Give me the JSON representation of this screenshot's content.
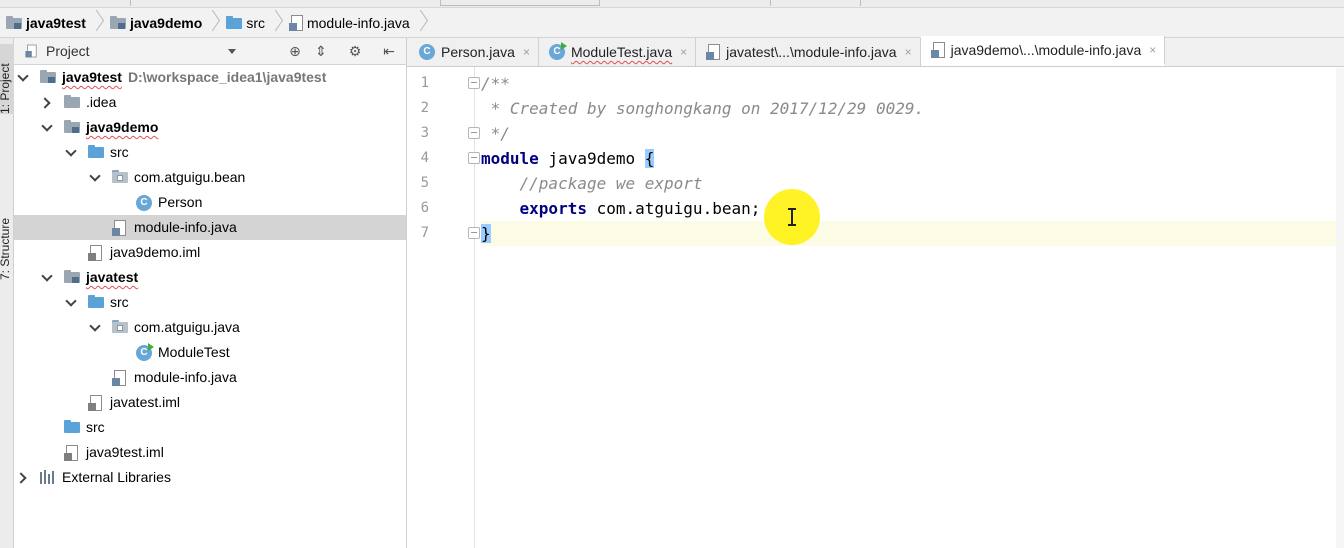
{
  "breadcrumbs": [
    {
      "label": "java9test",
      "icon": "module-folder-icon",
      "bold": true
    },
    {
      "label": "java9demo",
      "icon": "module-folder-icon",
      "bold": true
    },
    {
      "label": "src",
      "icon": "source-folder-icon",
      "bold": false
    },
    {
      "label": "module-info.java",
      "icon": "java-file-icon",
      "bold": false
    }
  ],
  "side_tabs": {
    "project": "1: Project",
    "structure": "7: Structure"
  },
  "project_panel": {
    "title": "Project",
    "tree": [
      {
        "label": "java9test",
        "path": "D:\\workspace_idea1\\java9test",
        "depth": 0,
        "expanded": true,
        "icon": "module-folder-icon",
        "bold": true
      },
      {
        "label": ".idea",
        "depth": 1,
        "expanded": false,
        "icon": "folder-icon"
      },
      {
        "label": "java9demo",
        "depth": 1,
        "expanded": true,
        "icon": "module-folder-icon",
        "bold": true
      },
      {
        "label": "src",
        "depth": 2,
        "expanded": true,
        "icon": "source-folder-icon"
      },
      {
        "label": "com.atguigu.bean",
        "depth": 3,
        "expanded": true,
        "icon": "package-icon"
      },
      {
        "label": "Person",
        "depth": 4,
        "icon": "class-icon"
      },
      {
        "label": "module-info.java",
        "depth": 3,
        "icon": "java-file-icon",
        "selected": true
      },
      {
        "label": "java9demo.iml",
        "depth": 2,
        "icon": "iml-file-icon"
      },
      {
        "label": "javatest",
        "depth": 1,
        "expanded": true,
        "icon": "module-folder-icon",
        "bold": true
      },
      {
        "label": "src",
        "depth": 2,
        "expanded": true,
        "icon": "source-folder-icon"
      },
      {
        "label": "com.atguigu.java",
        "depth": 3,
        "expanded": true,
        "icon": "package-icon"
      },
      {
        "label": "ModuleTest",
        "depth": 4,
        "icon": "runnable-class-icon"
      },
      {
        "label": "module-info.java",
        "depth": 3,
        "icon": "java-file-icon"
      },
      {
        "label": "javatest.iml",
        "depth": 2,
        "icon": "iml-file-icon"
      },
      {
        "label": "src",
        "depth": 1,
        "icon": "source-folder-icon"
      },
      {
        "label": "java9test.iml",
        "depth": 1,
        "icon": "iml-file-icon"
      },
      {
        "label": "External Libraries",
        "depth": 0,
        "expanded": false,
        "icon": "libraries-icon"
      }
    ]
  },
  "editor_tabs": [
    {
      "label": "Person.java",
      "icon": "class-icon",
      "active": false
    },
    {
      "label": "ModuleTest.java",
      "icon": "runnable-class-icon",
      "active": false
    },
    {
      "label": "javatest\\...\\module-info.java",
      "icon": "java-file-icon",
      "active": false
    },
    {
      "label": "java9demo\\...\\module-info.java",
      "icon": "java-file-icon",
      "active": true
    }
  ],
  "tab_close_glyph": "×",
  "code_lines": [
    {
      "n": "1",
      "text": "/**"
    },
    {
      "n": "2",
      "text": " * Created by songhongkang on 2017/12/29 0029."
    },
    {
      "n": "3",
      "text": " */"
    },
    {
      "n": "4",
      "kw": "module",
      "rest": " java9demo ",
      "brace": "{"
    },
    {
      "n": "5",
      "text": "    //package we export"
    },
    {
      "n": "6",
      "kw": "exports",
      "rest": " com.atguigu.bean;"
    },
    {
      "n": "7",
      "brace": "}"
    }
  ]
}
